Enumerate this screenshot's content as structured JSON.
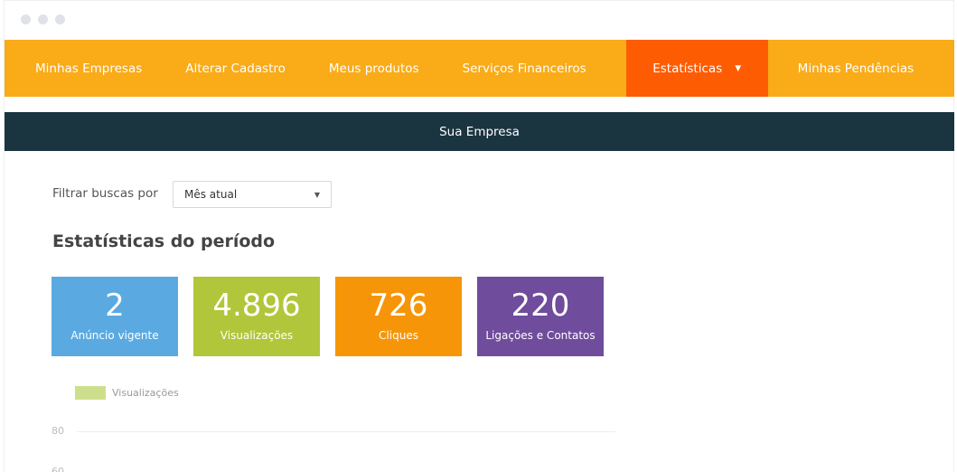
{
  "nav": {
    "items": [
      {
        "label": "Minhas Empresas"
      },
      {
        "label": "Alterar Cadastro"
      },
      {
        "label": "Meus produtos"
      },
      {
        "label": "Serviços Financeiros"
      },
      {
        "label": "Estatísticas",
        "active": true,
        "icon": "caret-down-icon"
      },
      {
        "label": "Minhas Pendências"
      }
    ]
  },
  "subheader": {
    "title": "Sua Empresa"
  },
  "filter": {
    "label": "Filtrar buscas por",
    "selected": "Mês atual"
  },
  "stats": {
    "title": "Estatísticas do período",
    "cards": [
      {
        "value": "2",
        "label": "Anúncio vigente",
        "color": "#5aaae1"
      },
      {
        "value": "4.896",
        "label": "Visualizações",
        "color": "#b1c63a"
      },
      {
        "value": "726",
        "label": "Cliques",
        "color": "#f79508"
      },
      {
        "value": "220",
        "label": "Ligações e Contatos",
        "color": "#6f4c9c"
      }
    ]
  },
  "chart_data": {
    "type": "bar",
    "series": [
      {
        "name": "Visualizações",
        "color": "#cddf8c",
        "values": []
      }
    ],
    "y_ticks": [
      "80",
      "60"
    ],
    "ylabel": "",
    "xlabel": ""
  },
  "colors": {
    "nav_bg": "#f9ab18",
    "nav_active": "#fe5c03",
    "subbar_bg": "#1b3540"
  }
}
